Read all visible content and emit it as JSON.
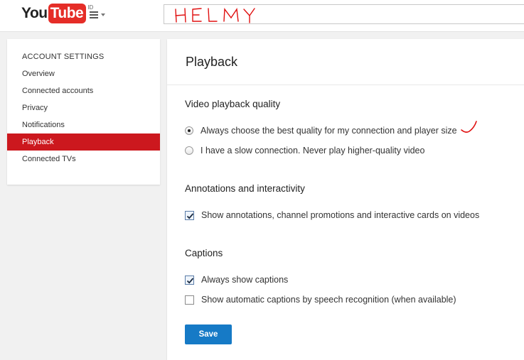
{
  "header": {
    "logo_you": "You",
    "logo_tube": "Tube",
    "logo_region": "ID",
    "handwritten_text": "HELMY"
  },
  "sidebar": {
    "title": "ACCOUNT SETTINGS",
    "items": [
      {
        "label": "Overview"
      },
      {
        "label": "Connected accounts"
      },
      {
        "label": "Privacy"
      },
      {
        "label": "Notifications"
      },
      {
        "label": "Playback",
        "active": true
      },
      {
        "label": "Connected TVs"
      }
    ]
  },
  "main": {
    "title": "Playback",
    "video_quality": {
      "title": "Video playback quality",
      "options": [
        {
          "label": "Always choose the best quality for my connection and player size",
          "selected": true
        },
        {
          "label": "I have a slow connection. Never play higher-quality video",
          "selected": false
        }
      ]
    },
    "annotations": {
      "title": "Annotations and interactivity",
      "options": [
        {
          "label": "Show annotations, channel promotions and interactive cards on videos",
          "checked": true
        }
      ]
    },
    "captions": {
      "title": "Captions",
      "options": [
        {
          "label": "Always show captions",
          "checked": true
        },
        {
          "label": "Show automatic captions by speech recognition (when available)",
          "checked": false
        }
      ]
    },
    "save_label": "Save"
  },
  "colors": {
    "brand_red": "#e52d27",
    "active_red": "#cc181e",
    "save_blue": "#167ac6",
    "handwriting_red": "#e01010"
  }
}
